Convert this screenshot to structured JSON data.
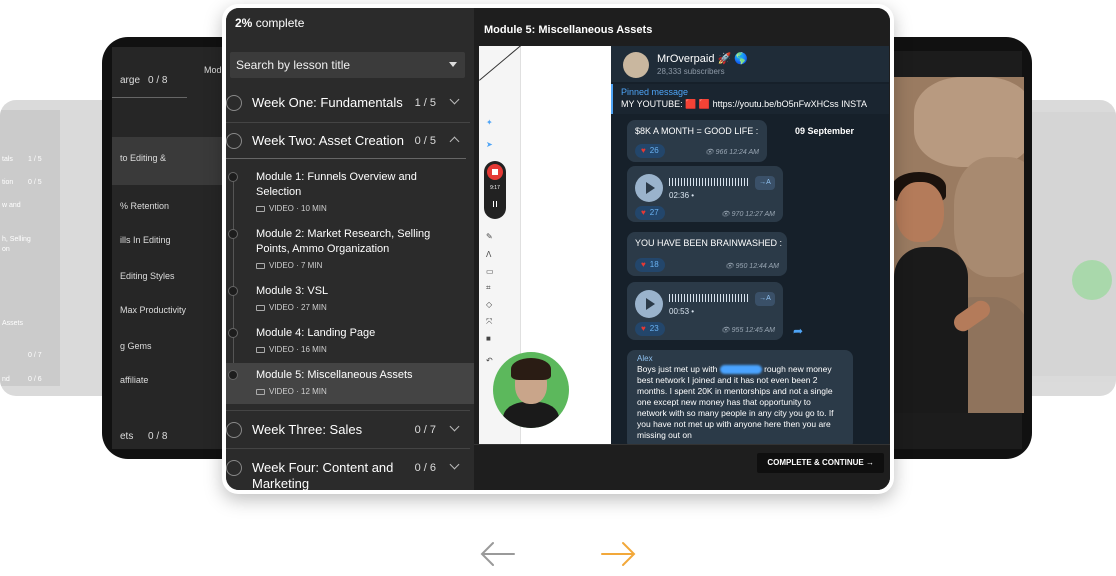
{
  "ghost_left": {
    "rows": [
      "tals",
      "1 / 5",
      "tion",
      "0 / 5",
      "w and",
      "h, Selling",
      "on",
      "Assets",
      "0 / 7",
      "nd",
      "0 / 6"
    ]
  },
  "mid_left": {
    "header_text": "arge",
    "header_count": "0 / 8",
    "tab_text": "Mod",
    "rows": [
      "to Editing &",
      "% Retention",
      "ills In Editing",
      "Editing Styles",
      "Max Productivity",
      "g Gems",
      "affiliate"
    ],
    "footer_text": "ets",
    "footer_count": "0 / 8"
  },
  "sidebar": {
    "progress_pct": "2%",
    "progress_word": "complete",
    "search_placeholder": "Search by lesson title",
    "weeks": [
      {
        "title": "Week One: Fundamentals",
        "count": "1 / 5"
      },
      {
        "title": "Week Two: Asset Creation",
        "count": "0 / 5"
      },
      {
        "title": "Week Three: Sales",
        "count": "0 / 7"
      },
      {
        "title": "Week Four: Content and Marketing",
        "count": "0 / 6"
      }
    ],
    "lessons": [
      {
        "title": "Module 1: Funnels Overview and Selection",
        "meta": "VIDEO · 10 MIN"
      },
      {
        "title": "Module 2: Market Research, Selling Points, Ammo Organization",
        "meta": "VIDEO · 7 MIN"
      },
      {
        "title": "Module 3: VSL",
        "meta": "VIDEO · 27 MIN"
      },
      {
        "title": "Module 4: Landing Page",
        "meta": "VIDEO · 16 MIN"
      },
      {
        "title": "Module 5: Miscellaneous Assets",
        "meta": "VIDEO · 12 MIN"
      }
    ]
  },
  "content": {
    "title": "Module 5: Miscellaneous Assets",
    "complete_button": "COMPLETE & CONTINUE",
    "recorder_time": "9:17"
  },
  "telegram": {
    "channel": "MrOverpaid 🚀 🌎",
    "subscribers": "28,333 subscribers",
    "pinned_label": "Pinned message",
    "pinned_text": "MY YOUTUBE: 🟥 🟥  https://youtu.be/bO5nFwXHCss   INSTA",
    "date": "09 September",
    "messages": [
      {
        "text": "$8K A MONTH = GOOD LIFE :",
        "likes": "26",
        "views": "966",
        "time": "12:24 AM"
      },
      {
        "duration": "02:36 •",
        "likes": "27",
        "views": "970",
        "time": "12:27 AM"
      },
      {
        "text": "YOU HAVE BEEN BRAINWASHED :",
        "likes": "18",
        "views": "950",
        "time": "12:44 AM"
      },
      {
        "duration": "00:53 •",
        "likes": "23",
        "views": "955",
        "time": "12:45 AM"
      }
    ],
    "transcribe_label": "→A",
    "alex_name": "Alex",
    "alex_text_1": "Boys just met up with",
    "alex_text_2": "rough new money best network I joined and it has not even been 2 months. I spent 20K in mentorships and not a single one except new money has that opportunity to network with so many people in any city you go to. If you have not met up with anyone here then you are missing out on"
  },
  "icons": {
    "heart": "♥",
    "eye": "👁",
    "forward": "➦",
    "arrow_right": "→"
  },
  "colors": {
    "accent_orange": "#f2a83a",
    "arrow_gray": "#9a9a9a",
    "record_red": "#e53935"
  }
}
